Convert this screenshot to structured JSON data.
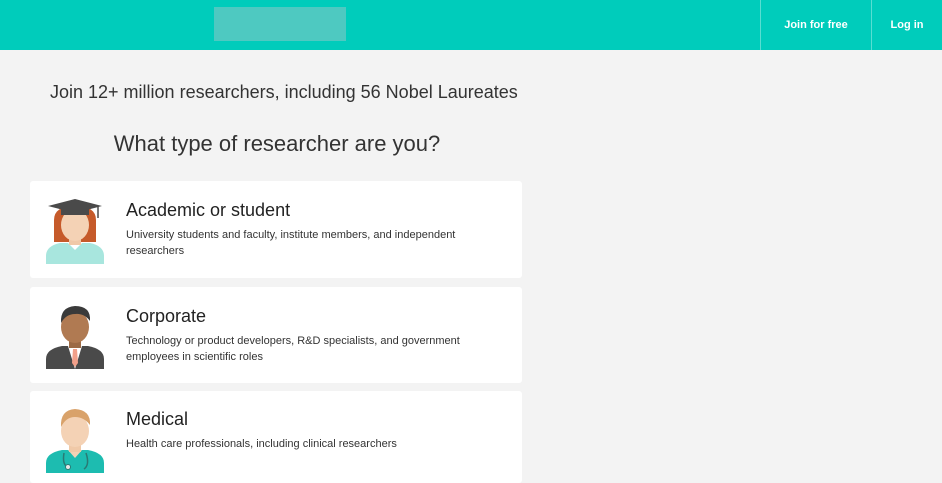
{
  "header": {
    "brand_color": "#00ccbb",
    "join_label": "Join for free",
    "login_label": "Log in"
  },
  "main": {
    "tagline": "Join 12+ million researchers, including 56 Nobel Laureates",
    "question": "What type of researcher are you?",
    "options": [
      {
        "title": "Academic or student",
        "description": "University students and faculty, institute members, and independent researchers",
        "icon": "graduate-avatar-icon"
      },
      {
        "title": "Corporate",
        "description": "Technology or product developers, R&D specialists, and government employees in scientific roles",
        "icon": "businessman-avatar-icon"
      },
      {
        "title": "Medical",
        "description": "Health care professionals, including clinical researchers",
        "icon": "doctor-avatar-icon"
      }
    ]
  }
}
